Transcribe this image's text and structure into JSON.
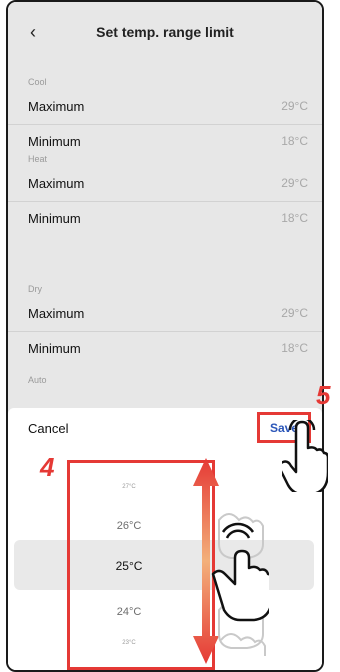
{
  "header": {
    "title": "Set temp. range limit"
  },
  "sections": [
    {
      "label": "Cool",
      "rows": [
        {
          "label": "Maximum",
          "value": "29°C"
        },
        {
          "label": "Minimum",
          "value": "18°C"
        }
      ]
    },
    {
      "label": "Heat",
      "rows": [
        {
          "label": "Maximum",
          "value": "29°C"
        },
        {
          "label": "Minimum",
          "value": "18°C"
        }
      ]
    },
    {
      "label": "Dry",
      "rows": [
        {
          "label": "Maximum",
          "value": "29°C"
        },
        {
          "label": "Minimum",
          "value": "18°C"
        }
      ]
    },
    {
      "label": "Auto",
      "rows": []
    }
  ],
  "sheet": {
    "cancel_label": "Cancel",
    "save_label": "Save",
    "picker_options": [
      "27°C",
      "26°C",
      "25°C",
      "24°C",
      "23°C"
    ],
    "selected": "25°C"
  },
  "callouts": {
    "step_picker": "4",
    "step_save": "5"
  },
  "colors": {
    "accent_red": "#e53935",
    "save_blue": "#2a55b8",
    "background": "#e7e7e7"
  }
}
